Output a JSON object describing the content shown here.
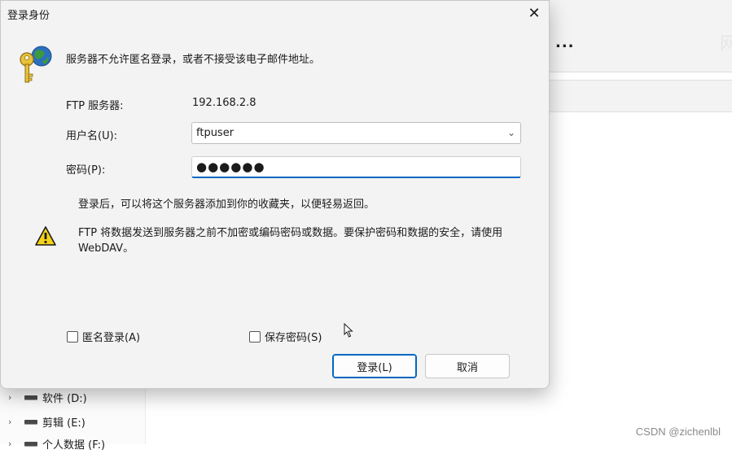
{
  "dialog": {
    "title": "登录身份",
    "close_glyph": "✕",
    "message": "服务器不允许匿名登录，或者不接受该电子邮件地址。",
    "server_label": "FTP 服务器:",
    "server_value": "192.168.2.8",
    "username_label": "用户名(U):",
    "username_value": "ftpuser",
    "password_label": "密码(P):",
    "password_mask": "●●●●●●",
    "info_note": "登录后，可以将这个服务器添加到你的收藏夹，以便轻易返回。",
    "warning_text": "FTP 将数据发送到服务器之前不加密或编码密码或数据。要保护密码和数据的安全，请使用 WebDAV。",
    "anonymous_label": "匿名登录(A)",
    "anonymous_checked": false,
    "save_password_label": "保存密码(S)",
    "save_password_checked": false,
    "login_button": "登录(L)",
    "cancel_button": "取消",
    "icons": {
      "keys": "keys-globe-icon",
      "warning": "warning-icon",
      "dropdown": "chevron-down-icon"
    }
  },
  "background": {
    "more_glyph": "...",
    "faint_text": "网",
    "tree": [
      {
        "chevron": "›",
        "label": "软件 (D:)"
      },
      {
        "chevron": "›",
        "label": "剪辑 (E:)"
      },
      {
        "chevron": "›",
        "label": "个人数据 (F:)"
      }
    ]
  },
  "watermark": "CSDN @zichenlbl"
}
